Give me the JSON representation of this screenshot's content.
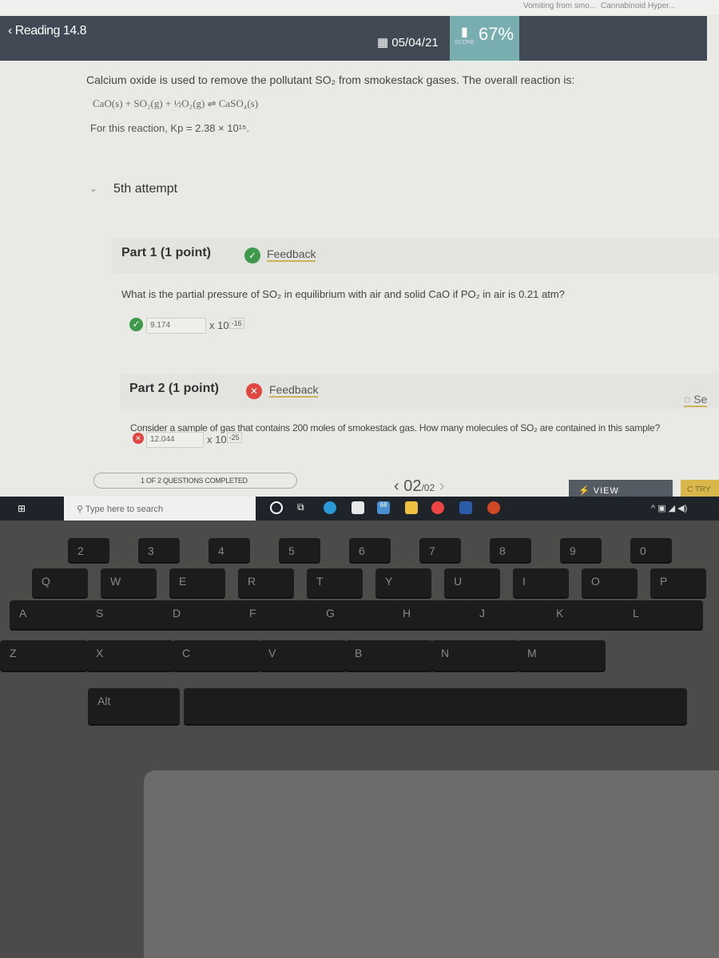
{
  "browser_tabs": [
    "Vomiting from smo...",
    "Cannabinoid Hyper..."
  ],
  "header": {
    "back_label": "Reading 14.8",
    "date": "05/04/21",
    "score_label": "SCORE",
    "score": "67%"
  },
  "problem": {
    "intro": "Calcium oxide is used to remove the pollutant SO₂ from smokestack gases. The overall reaction is:",
    "equation": "CaO(s) + SO₂(g) + ½O₂(g) ⇌ CaSO₄(s)",
    "kp_text": "For this reaction, Kp = 2.38 × 10¹⁵."
  },
  "attempt_label": "5th attempt",
  "parts": [
    {
      "title": "Part 1  (1 point)",
      "feedback": "Feedback",
      "status": "correct",
      "question": "What is the partial pressure of SO₂ in equilibrium with air and solid CaO if PO₂ in air is 0.21 atm?",
      "answer": "9.174",
      "exponent": "-16"
    },
    {
      "title": "Part 2  (1 point)",
      "feedback": "Feedback",
      "status": "incorrect",
      "question": "Consider a sample of gas that contains 200  moles of smokestack gas. How many molecules of SO₂ are contained in this sample?",
      "answer": "12.044",
      "exponent": "-25",
      "hint": "Se"
    }
  ],
  "times_label": "x 10",
  "footer": {
    "progress": "1 OF 2 QUESTIONS COMPLETED",
    "progress_fraction": 0.5,
    "page_current": "02",
    "page_total": "/02",
    "view_solution": "VIEW SOLUTION",
    "try_again": "TRY"
  },
  "taskbar": {
    "search_placeholder": "Type here to search",
    "mail_badge": "68"
  },
  "keyboard": {
    "row_num": [
      "2",
      "3",
      "4",
      "5",
      "6",
      "7",
      "8",
      "9",
      "0"
    ],
    "row_q": [
      "Q",
      "W",
      "E",
      "R",
      "T",
      "Y",
      "U",
      "I",
      "O",
      "P"
    ],
    "row_a": [
      "A",
      "S",
      "D",
      "F",
      "G",
      "H",
      "J",
      "K",
      "L"
    ],
    "row_z": [
      "Z",
      "X",
      "C",
      "V",
      "B",
      "N",
      "M"
    ],
    "alt": "Alt"
  }
}
